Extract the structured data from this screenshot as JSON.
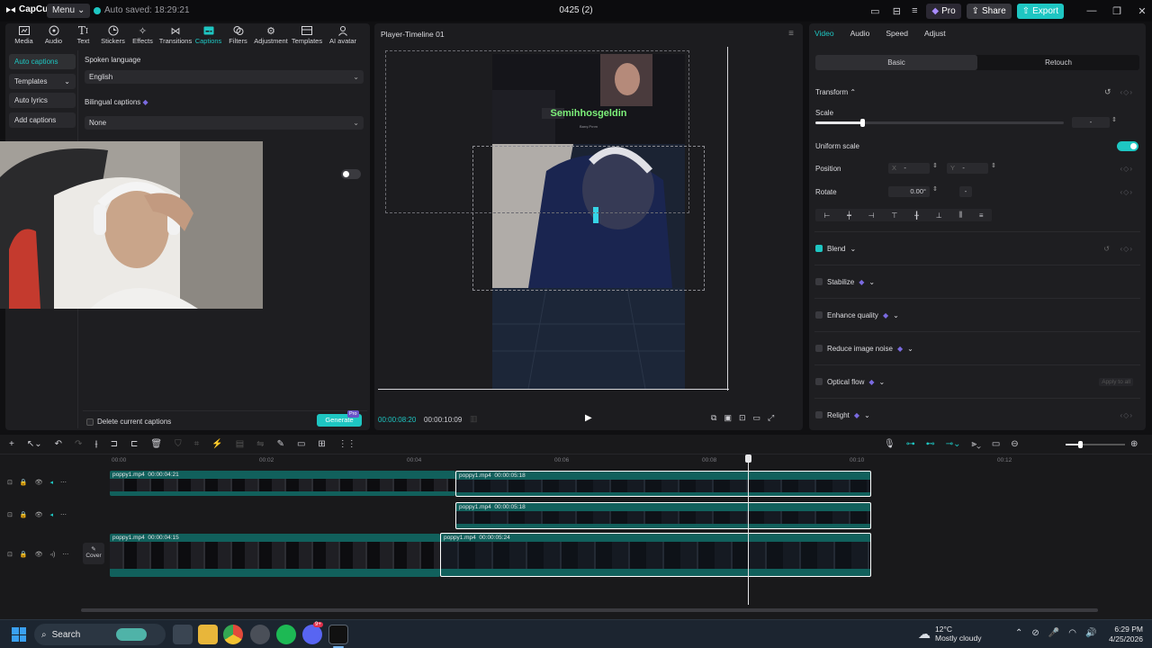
{
  "titlebar": {
    "logo": "CapCut",
    "menu_label": "Menu",
    "autosave": "Auto saved: 18:29:21",
    "project_title": "0425 (2)",
    "pro_label": "Pro",
    "share_label": "Share",
    "export_label": "Export"
  },
  "toolbar": {
    "items": [
      {
        "label": "Media",
        "icon": "media-icon"
      },
      {
        "label": "Audio",
        "icon": "audio-icon"
      },
      {
        "label": "Text",
        "icon": "text-icon"
      },
      {
        "label": "Stickers",
        "icon": "stickers-icon"
      },
      {
        "label": "Effects",
        "icon": "effects-icon"
      },
      {
        "label": "Transitions",
        "icon": "transitions-icon"
      },
      {
        "label": "Captions",
        "icon": "captions-icon",
        "active": true
      },
      {
        "label": "Filters",
        "icon": "filters-icon"
      },
      {
        "label": "Adjustment",
        "icon": "adjustment-icon"
      },
      {
        "label": "Templates",
        "icon": "templates-icon"
      },
      {
        "label": "AI avatar",
        "icon": "ai-avatar-icon"
      }
    ]
  },
  "captions_panel": {
    "subnav": [
      "Auto captions",
      "Templates",
      "Auto lyrics",
      "Add captions"
    ],
    "spoken_language_label": "Spoken language",
    "spoken_language_value": "English",
    "bilingual_label": "Bilingual captions",
    "bilingual_value": "None",
    "delete_label": "Delete current captions",
    "generate_label": "Generate",
    "pro_tag": "Pro"
  },
  "player": {
    "title": "Player-Timeline 01",
    "overlay_text": "Semihhosgeldin",
    "overlay_sub": "Barış Pırım",
    "time_current": "00:00:08:20",
    "time_total": "00:00:10:09"
  },
  "inspector": {
    "tabs": [
      "Video",
      "Audio",
      "Speed",
      "Adjust"
    ],
    "active_tab": "Video",
    "segments": [
      "Basic",
      "Retouch"
    ],
    "transform_label": "Transform",
    "scale_label": "Scale",
    "scale_value": "-",
    "scale_level": 0.19,
    "uniform_scale_label": "Uniform scale",
    "position_label": "Position",
    "pos_x_label": "X",
    "pos_x_value": "-",
    "pos_y_label": "Y",
    "pos_y_value": "-",
    "rotate_label": "Rotate",
    "rotate_value": "0.00°",
    "rotate_dash": "-",
    "blend_label": "Blend",
    "stabilize_label": "Stabilize",
    "enhance_label": "Enhance quality",
    "noise_label": "Reduce image noise",
    "optical_label": "Optical flow",
    "apply_all": "Apply to all",
    "relight_label": "Relight"
  },
  "timeline": {
    "ruler": [
      "00:00",
      "00:02",
      "00:04",
      "00:06",
      "00:08",
      "00:10",
      "00:12"
    ],
    "cover_label": "Cover",
    "clips": [
      {
        "name": "poppy1.mp4",
        "duration": "00:00:04:21"
      },
      {
        "name": "poppy1.mp4",
        "duration": "00:00:05:18"
      },
      {
        "name": "poppy1.mp4",
        "duration": "00:00:05:18"
      },
      {
        "name": "poppy1.mp4",
        "duration": "00:00:04:15"
      },
      {
        "name": "poppy1.mp4",
        "duration": "00:00:05:24"
      }
    ]
  },
  "taskbar": {
    "search_label": "Search",
    "temperature": "12°C",
    "weather": "Mostly cloudy",
    "time": "6:29 PM",
    "date": "4/25/2026",
    "discord_badge": "9+"
  },
  "colors": {
    "accent": "#1ec6c2",
    "clip_teal": "#11605c",
    "pro_purple": "#7a6ae0"
  }
}
